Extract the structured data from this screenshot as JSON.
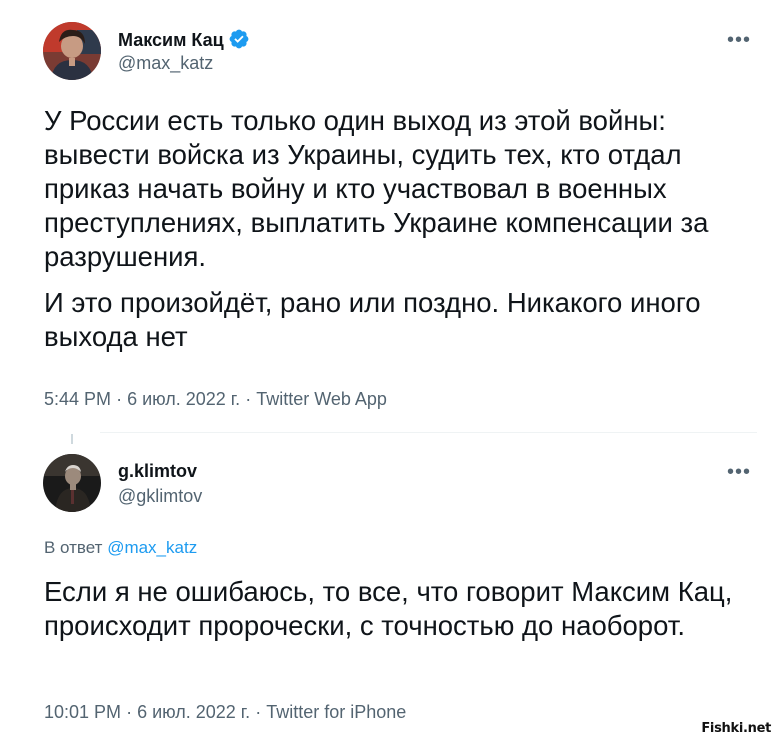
{
  "tweet1": {
    "name": "Максим Кац",
    "handle": "@max_katz",
    "paragraph1": "У России есть только один выход из этой войны: вывести войска из Украины, судить тех, кто отдал приказ начать войну и кто участвовал в военных преступлениях, выплатить Украине компенсации за разрушения.",
    "paragraph2": "И это произойдёт, рано или поздно. Никакого иного выхода нет",
    "time": "5:44 PM",
    "date": "6 июл. 2022 г.",
    "source": "Twitter Web App",
    "more_label": "•••"
  },
  "tweet2": {
    "name": "g.klimtov",
    "handle": "@gklimtov",
    "reply_prefix": "В ответ",
    "reply_handle": "@max_katz",
    "text": "Если я не ошибаюсь, то все, что говорит Максим Кац, происходит пророчески, с точностью до наоборот.",
    "time": "10:01 PM",
    "date": "6 июл. 2022 г.",
    "source": "Twitter for iPhone",
    "more_label": "•••"
  },
  "separator": "·",
  "watermark": "Fishki.net",
  "colors": {
    "text": "#0f1419",
    "secondary": "#536471",
    "link": "#1d9bf0",
    "verified": "#1d9bf0"
  }
}
